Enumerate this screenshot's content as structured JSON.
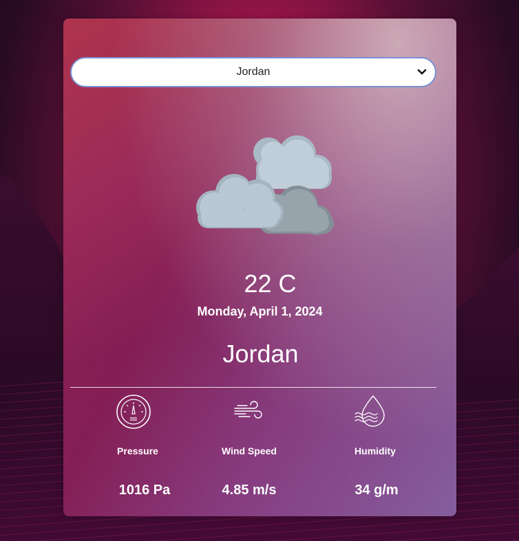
{
  "location_select": {
    "selected": "Jordan"
  },
  "weather": {
    "condition_icon": "cloudy-icon",
    "temperature": "22 C",
    "date": "Monday, April 1, 2024",
    "city": "Jordan"
  },
  "stats": [
    {
      "icon": "pressure-gauge-icon",
      "label": "Pressure",
      "value": "1016 Pa"
    },
    {
      "icon": "wind-icon",
      "label": "Wind Speed",
      "value": "4.85 m/s"
    },
    {
      "icon": "humidity-icon",
      "label": "Humidity",
      "value": "34 g/m"
    }
  ]
}
